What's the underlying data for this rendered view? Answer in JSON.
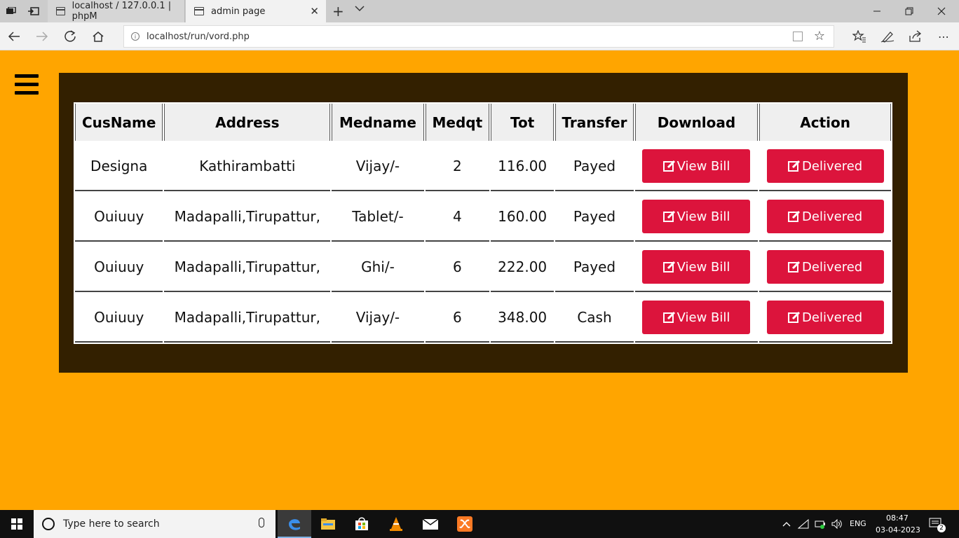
{
  "browser": {
    "tabs": [
      {
        "title": "localhost / 127.0.0.1 | phpM",
        "active": false
      },
      {
        "title": "admin page",
        "active": true
      }
    ],
    "url": "localhost/run/vord.php"
  },
  "table": {
    "headers": [
      "CusName",
      "Address",
      "Medname",
      "Medqt",
      "Tot",
      "Transfer",
      "Download",
      "Action"
    ],
    "rows": [
      {
        "cusname": "Designa",
        "address": "Kathirambatti",
        "medname": "Vijay/-",
        "medqt": "2",
        "tot": "116.00",
        "transfer": "Payed",
        "download": "View Bill",
        "action": "Delivered"
      },
      {
        "cusname": "Ouiuuy",
        "address": "Madapalli,Tirupattur,",
        "medname": "Tablet/-",
        "medqt": "4",
        "tot": "160.00",
        "transfer": "Payed",
        "download": "View Bill",
        "action": "Delivered"
      },
      {
        "cusname": "Ouiuuy",
        "address": "Madapalli,Tirupattur,",
        "medname": "Ghi/-",
        "medqt": "6",
        "tot": "222.00",
        "transfer": "Payed",
        "download": "View Bill",
        "action": "Delivered"
      },
      {
        "cusname": "Ouiuuy",
        "address": "Madapalli,Tirupattur,",
        "medname": "Vijay/-",
        "medqt": "6",
        "tot": "348.00",
        "transfer": "Cash",
        "download": "View Bill",
        "action": "Delivered"
      }
    ]
  },
  "taskbar": {
    "search_placeholder": "Type here to search",
    "lang": "ENG",
    "time": "08:47",
    "date": "03-04-2023",
    "notifications": "2"
  },
  "colors": {
    "page_bg": "#ffa500",
    "panel_bg": "#332000",
    "button_bg": "#dc143c"
  }
}
